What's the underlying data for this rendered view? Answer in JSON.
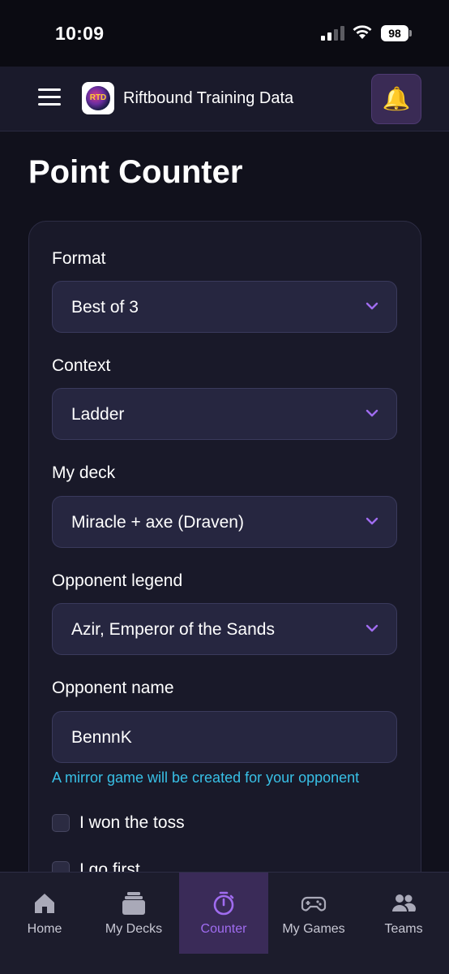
{
  "status_bar": {
    "time": "10:09",
    "battery": "98"
  },
  "header": {
    "logo_text": "RTD",
    "app_title": "Riftbound Training Data",
    "bell_icon": "🔔"
  },
  "page": {
    "title": "Point Counter"
  },
  "form": {
    "format": {
      "label": "Format",
      "value": "Best of 3"
    },
    "context": {
      "label": "Context",
      "value": "Ladder"
    },
    "my_deck": {
      "label": "My deck",
      "value": "Miracle + axe (Draven)"
    },
    "opponent_legend": {
      "label": "Opponent legend",
      "value": "Azir, Emperor of the Sands"
    },
    "opponent_name": {
      "label": "Opponent name",
      "value": "BennnK"
    },
    "mirror_hint": "A mirror game will be created for your opponent",
    "won_toss": {
      "label": "I won the toss",
      "checked": false
    },
    "go_first": {
      "label": "I go first",
      "checked": false
    }
  },
  "nav": {
    "items": [
      {
        "label": "Home",
        "icon": "home-icon"
      },
      {
        "label": "My Decks",
        "icon": "decks-icon"
      },
      {
        "label": "Counter",
        "icon": "stopwatch-icon",
        "active": true
      },
      {
        "label": "My Games",
        "icon": "gamepad-icon"
      },
      {
        "label": "Teams",
        "icon": "users-icon"
      }
    ]
  },
  "colors": {
    "accent": "#a06cf0",
    "hint": "#38c0e6",
    "background": "#11111c",
    "card": "#191929",
    "input": "#262640"
  }
}
